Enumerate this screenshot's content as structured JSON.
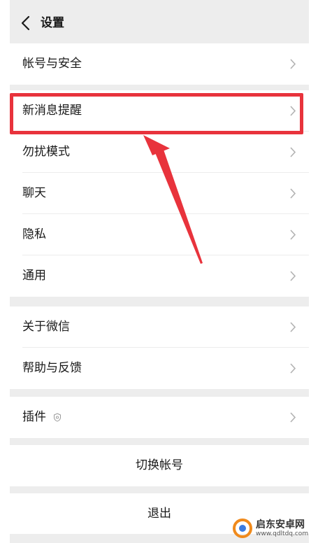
{
  "header": {
    "title": "设置"
  },
  "groups": [
    {
      "items": [
        {
          "label": "帐号与安全"
        }
      ]
    },
    {
      "items": [
        {
          "label": "新消息提醒"
        },
        {
          "label": "勿扰模式"
        },
        {
          "label": "聊天"
        },
        {
          "label": "隐私"
        },
        {
          "label": "通用"
        }
      ]
    },
    {
      "items": [
        {
          "label": "关于微信"
        },
        {
          "label": "帮助与反馈"
        }
      ]
    },
    {
      "items": [
        {
          "label": "插件"
        }
      ]
    }
  ],
  "switch_account": "切换帐号",
  "logout": "退出",
  "watermark": {
    "brand": "启东安卓网",
    "url": "www.qdltdq.com"
  },
  "colors": {
    "highlight": "#e8333c",
    "background": "#ededed",
    "panel": "#ffffff"
  }
}
